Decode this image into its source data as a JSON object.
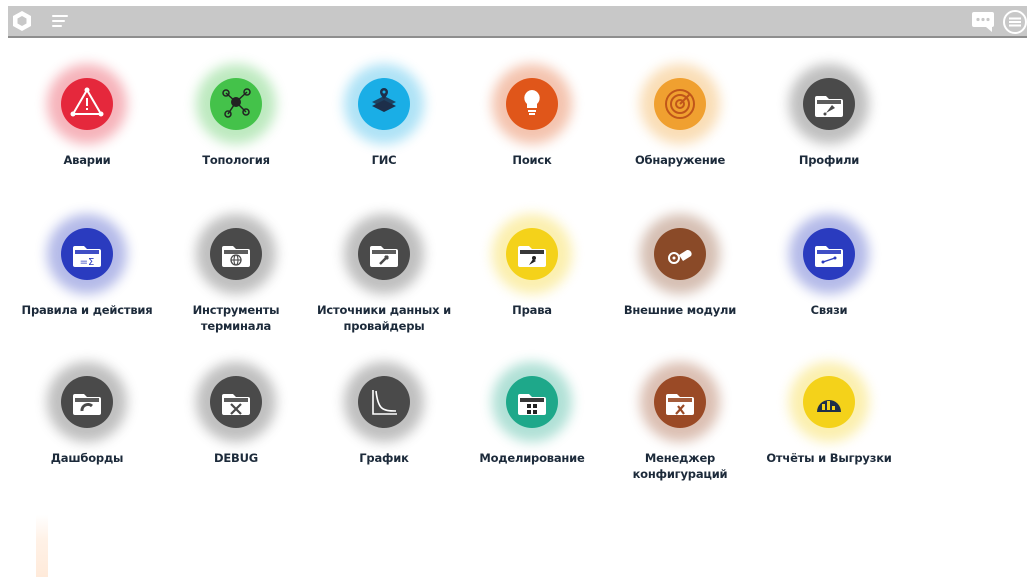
{
  "colors": {
    "topbar": "#c8c8c8",
    "label": "#1c2a3a",
    "red": "#e5283c",
    "green": "#44c24a",
    "cyan": "#1aaee6",
    "orange": "#e0561a",
    "amber": "#f0a030",
    "dark": "#4a4a4a",
    "blue": "#2a3bbf",
    "yellow": "#f4d21a",
    "brown": "#8a4a28",
    "teal": "#1ea88a",
    "rust": "#9a4a26"
  },
  "topbar": {
    "logo_icon": "hexagon-logo-icon",
    "menu_icon": "hamburger-icon",
    "chat_icon": "chat-icon",
    "settings_icon": "circle-menu-icon"
  },
  "tiles": [
    {
      "label": "Аварии",
      "label2": "",
      "icon": "alert-triangle-icon",
      "color": "red"
    },
    {
      "label": "Топология",
      "label2": "",
      "icon": "network-nodes-icon",
      "color": "green"
    },
    {
      "label": "ГИС",
      "label2": "",
      "icon": "layers-pin-icon",
      "color": "cyan"
    },
    {
      "label": "Поиск",
      "label2": "",
      "icon": "lightbulb-icon",
      "color": "orange"
    },
    {
      "label": "Обнаружение",
      "label2": "",
      "icon": "radar-icon",
      "color": "amber"
    },
    {
      "label": "Профили",
      "label2": "",
      "icon": "folder-rocket-icon",
      "color": "dark"
    },
    {
      "label": "Правила и действия",
      "label2": "",
      "icon": "folder-sum-icon",
      "color": "blue"
    },
    {
      "label": "Инструменты",
      "label2": "терминала",
      "icon": "folder-globe-icon",
      "color": "dark"
    },
    {
      "label": "Источники данных и",
      "label2": "провайдеры",
      "icon": "folder-plug-icon",
      "color": "dark"
    },
    {
      "label": "Права",
      "label2": "",
      "icon": "folder-key-icon",
      "color": "yellow"
    },
    {
      "label": "Внешние модули",
      "label2": "",
      "icon": "plug-cable-icon",
      "color": "brown"
    },
    {
      "label": "Связи",
      "label2": "",
      "icon": "folder-link-icon",
      "color": "blue"
    },
    {
      "label": "Дашборды",
      "label2": "",
      "icon": "folder-gauge-icon",
      "color": "dark"
    },
    {
      "label": "DEBUG",
      "label2": "",
      "icon": "folder-tools-icon",
      "color": "dark"
    },
    {
      "label": "График",
      "label2": "",
      "icon": "curve-chart-icon",
      "color": "dark"
    },
    {
      "label": "Моделирование",
      "label2": "",
      "icon": "folder-grid-icon",
      "color": "teal"
    },
    {
      "label": "Менеджер",
      "label2": "конфигураций",
      "icon": "folder-wrench-icon",
      "color": "rust"
    },
    {
      "label": "Отчёты и Выгрузки",
      "label2": "",
      "icon": "report-export-icon",
      "color": "yellow"
    }
  ]
}
